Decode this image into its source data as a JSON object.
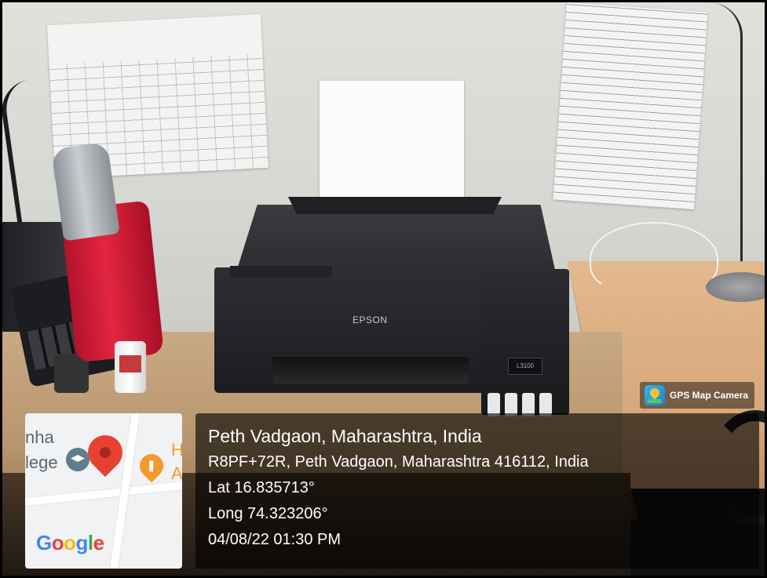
{
  "overlay": {
    "app_badge": {
      "icon": "gps-map-camera-icon",
      "name": "GPS Map Camera"
    },
    "map": {
      "labels": [
        "nha",
        "lege",
        "H",
        "A"
      ],
      "provider_logo": [
        "G",
        "o",
        "o",
        "g",
        "l",
        "e"
      ],
      "icons": [
        "map-pin-icon",
        "school-icon",
        "restaurant-icon"
      ]
    },
    "location": {
      "title": "Peth Vadgaon, Maharashtra, India",
      "address": "R8PF+72R, Peth Vadgaon, Maharashtra 416112, India",
      "latitude": "Lat 16.835713°",
      "longitude": "Long 74.323206°",
      "datetime": "04/08/22 01:30 PM"
    }
  },
  "photo": {
    "printer_brand": "EPSON",
    "printer_model": "L3100"
  },
  "colors": {
    "pin": "#e64133",
    "overlay_bg": "rgba(0,0,0,0.62)",
    "google_blue": "#4285f4",
    "google_red": "#ea4335",
    "google_yellow": "#fbbc05",
    "google_green": "#34a853"
  }
}
